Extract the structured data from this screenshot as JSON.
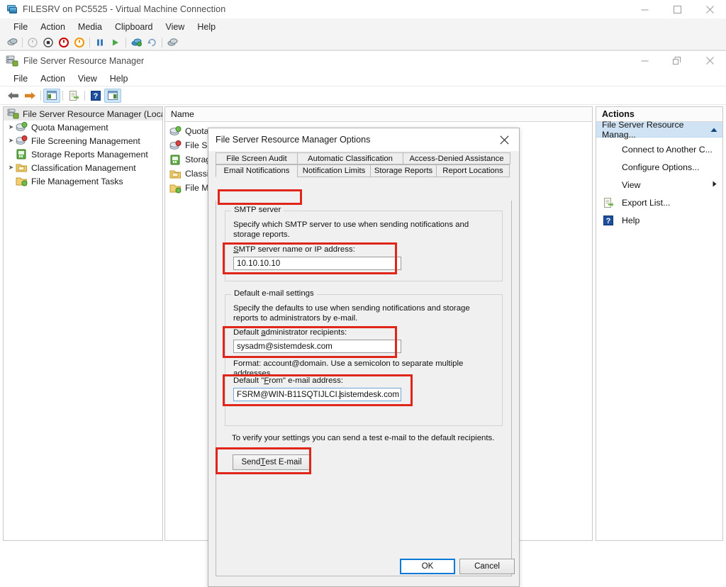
{
  "vm_window": {
    "title": "FILESRV on PC5525 - Virtual Machine Connection",
    "icon": "virtual-machine-icon",
    "menus": [
      "File",
      "Action",
      "Media",
      "Clipboard",
      "View",
      "Help"
    ],
    "window_controls": {
      "minimize": "─",
      "maximize": "☐",
      "close": "✕"
    },
    "toolbar_icons": [
      "ctrl-alt-del-icon",
      "start-icon",
      "shutdown-icon",
      "turn-off-icon",
      "reset-icon",
      "pause-icon",
      "resume-icon",
      "checkpoint-icon",
      "revert-icon",
      "enhanced-session-icon"
    ]
  },
  "mmc_window": {
    "title": "File Server Resource Manager",
    "icon": "file-server-resource-manager-icon",
    "menus": [
      "File",
      "Action",
      "View",
      "Help"
    ],
    "window_controls": {
      "minimize": "─",
      "restore": "❐",
      "close": "✕"
    },
    "toolbar_icons": [
      "back-arrow-icon",
      "forward-arrow-icon",
      "show-hide-console-tree-icon",
      "export-list-icon",
      "help-icon",
      "show-hide-action-pane-icon"
    ]
  },
  "tree": {
    "root": {
      "label": "File Server Resource Manager (Local)",
      "icon": "fsrm-root-icon",
      "selected": true
    },
    "items": [
      {
        "label": "Quota Management",
        "icon": "quota-management-icon",
        "expandable": true
      },
      {
        "label": "File Screening Management",
        "icon": "file-screening-icon",
        "expandable": true
      },
      {
        "label": "Storage Reports Management",
        "icon": "storage-reports-icon",
        "expandable": false
      },
      {
        "label": "Classification Management",
        "icon": "classification-icon",
        "expandable": true
      },
      {
        "label": "File Management Tasks",
        "icon": "file-management-tasks-icon",
        "expandable": false
      }
    ]
  },
  "middle_pane": {
    "column_header": "Name",
    "rows": [
      {
        "label": "Quota",
        "icon": "quota-management-icon"
      },
      {
        "label": "File Scr",
        "icon": "file-screening-icon"
      },
      {
        "label": "Storage",
        "icon": "storage-reports-icon"
      },
      {
        "label": "Classifi",
        "icon": "classification-icon"
      },
      {
        "label": "File Ma",
        "icon": "file-management-tasks-icon"
      }
    ]
  },
  "actions_pane": {
    "header": "Actions",
    "group_label": "File Server Resource Manag...",
    "group_collapse_icon": "chevron-up-icon",
    "items": [
      {
        "label": "Connect to Another C...",
        "icon": null,
        "submenu": false
      },
      {
        "label": "Configure Options...",
        "icon": null,
        "submenu": false
      },
      {
        "label": "View",
        "icon": null,
        "submenu": true,
        "submenu_icon": "chevron-right-icon"
      },
      {
        "label": "Export List...",
        "icon": "export-list-icon",
        "submenu": false
      },
      {
        "label": "Help",
        "icon": "help-icon",
        "submenu": false
      }
    ]
  },
  "dialog": {
    "title": "File Server Resource Manager Options",
    "close_icon": "close-icon",
    "tabs_row1": [
      "File Screen Audit",
      "Automatic Classification",
      "Access-Denied Assistance"
    ],
    "tabs_row2": [
      "Email Notifications",
      "Notification Limits",
      "Storage Reports",
      "Report Locations"
    ],
    "active_tab": "Email Notifications",
    "smtp_group": {
      "title": "SMTP server",
      "description": "Specify which SMTP server to use when sending notifications and storage reports.",
      "field_label": "SMTP server name or IP address:",
      "field_label_accel": "S",
      "field_value": "10.10.10.10"
    },
    "email_group": {
      "title": "Default e-mail settings",
      "description": "Specify the defaults to use when sending notifications and storage reports to administrators by e-mail.",
      "admin_label": "Default administrator recipients:",
      "admin_label_accel": "a",
      "admin_value": "sysadm@sistemdesk.com",
      "format_hint": "Format: account@domain. Use a semicolon to separate multiple addresses",
      "from_label": "Default “From” e-mail address:",
      "from_label_accel": "F",
      "from_value_before_caret": "FSRM@WIN-B11SQTIJLCI.",
      "from_value_after_caret": "sistemdesk.com",
      "verify_text": "To verify your settings you can send a test e-mail to the default recipients.",
      "test_button": "Send Test E-mail",
      "test_button_accel": "T"
    },
    "footer": {
      "ok": "OK",
      "cancel": "Cancel",
      "ok_focused": true
    }
  },
  "annotations": {
    "highlight_color": "#e0251b",
    "boxes": [
      {
        "name": "email-notifications-tab-highlight"
      },
      {
        "name": "smtp-server-field-highlight"
      },
      {
        "name": "admin-recipients-field-highlight"
      },
      {
        "name": "from-address-field-highlight"
      },
      {
        "name": "send-test-email-button-highlight"
      }
    ]
  }
}
